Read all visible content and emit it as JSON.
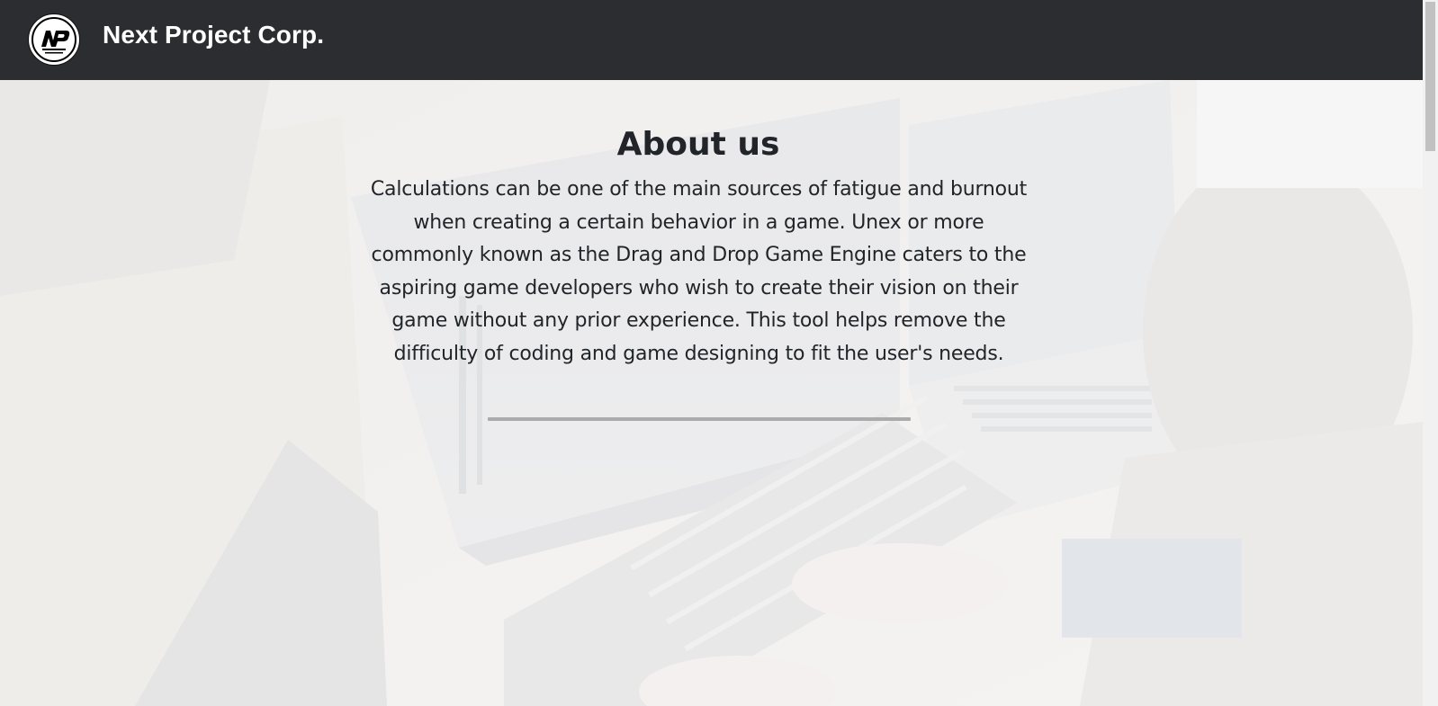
{
  "header": {
    "logo_icon": "next-project-corp-logo",
    "brand_name": "Next Project Corp.",
    "background_color": "#2b2d31"
  },
  "about": {
    "title": "About us",
    "body": "Calculations can be one of the main sources of fatigue and burnout when creating a certain behavior in a game. Unex or more commonly known as the Drag and Drop Game Engine caters to the aspiring game developers who wish to create their vision on their game without any prior experience. This tool helps remove the difficulty of coding and game designing to fit the user's needs."
  },
  "background_image": "people-coding-on-computers-photo",
  "text_color": "#212529",
  "divider_color": "#a9abad"
}
